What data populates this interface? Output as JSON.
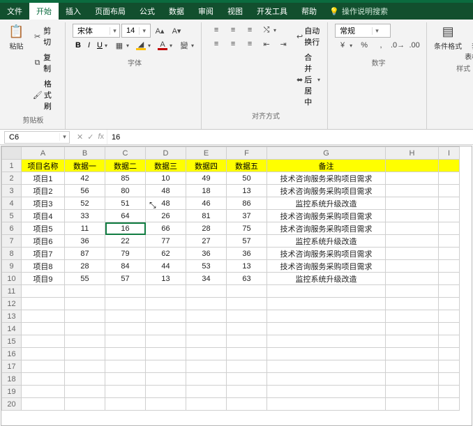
{
  "menu": {
    "items": [
      "文件",
      "开始",
      "插入",
      "页面布局",
      "公式",
      "数据",
      "审阅",
      "视图",
      "开发工具",
      "帮助"
    ],
    "active_index": 1,
    "hint_icon": "lightbulb-icon",
    "hint_text": "操作说明搜索"
  },
  "ribbon": {
    "clipboard": {
      "paste_label": "粘贴",
      "cut_label": "剪切",
      "copy_label": "复制",
      "format_painter_label": "格式刷",
      "group_label": "剪贴板"
    },
    "font": {
      "font_name": "宋体",
      "font_size": "14",
      "group_label": "字体"
    },
    "align": {
      "wrap_label": "自动换行",
      "merge_label": "合并后居中",
      "group_label": "对齐方式"
    },
    "number": {
      "format": "常规",
      "group_label": "数字"
    },
    "styles": {
      "cond_fmt_label": "条件格式",
      "table_fmt_label": "套用\n表格格式",
      "group_label": "样式"
    }
  },
  "namebox": {
    "cell_ref": "C6",
    "formula_value": "16"
  },
  "sheet": {
    "col_headers": [
      "A",
      "B",
      "C",
      "D",
      "E",
      "F",
      "G",
      "H",
      "I"
    ],
    "header_row": [
      "项目名称",
      "数据一",
      "数据二",
      "数据三",
      "数据四",
      "数据五",
      "备注"
    ],
    "rows": [
      {
        "name": "项目1",
        "d": [
          42,
          85,
          10,
          49,
          50
        ],
        "note": "技术咨询服务采购项目需求"
      },
      {
        "name": "项目2",
        "d": [
          56,
          80,
          48,
          18,
          13
        ],
        "note": "技术咨询服务采购项目需求"
      },
      {
        "name": "项目3",
        "d": [
          52,
          51,
          48,
          46,
          86
        ],
        "note": "监控系统升级改造"
      },
      {
        "name": "项目4",
        "d": [
          33,
          64,
          26,
          81,
          37
        ],
        "note": "技术咨询服务采购项目需求"
      },
      {
        "name": "项目5",
        "d": [
          11,
          16,
          66,
          28,
          75
        ],
        "note": "技术咨询服务采购项目需求"
      },
      {
        "name": "项目6",
        "d": [
          36,
          22,
          77,
          27,
          57
        ],
        "note": "监控系统升级改造"
      },
      {
        "name": "项目7",
        "d": [
          87,
          79,
          62,
          36,
          36
        ],
        "note": "技术咨询服务采购项目需求"
      },
      {
        "name": "项目8",
        "d": [
          28,
          84,
          44,
          53,
          13
        ],
        "note": "技术咨询服务采购项目需求"
      },
      {
        "name": "项目9",
        "d": [
          55,
          57,
          13,
          34,
          63
        ],
        "note": "监控系统升级改造"
      }
    ],
    "selected_cell": "C6",
    "row_count_visible": 20
  }
}
